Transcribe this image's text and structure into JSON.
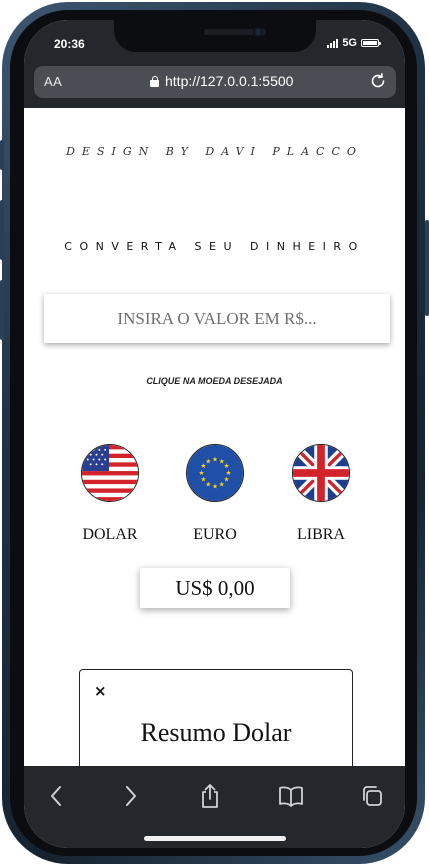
{
  "status_bar": {
    "time": "20:36",
    "network": "5G"
  },
  "browser": {
    "text_size_label": "AA",
    "url": "http://127.0.0.1:5500"
  },
  "page": {
    "credit": "DESIGN BY DAVI PLACCO",
    "headline": "CONVERTA SEU DINHEIRO",
    "input": {
      "placeholder": "INSIRA O VALOR EM R$...",
      "value": ""
    },
    "hint": "CLIQUE NA MOEDA DESEJADA",
    "currencies": [
      {
        "label": "DOLAR",
        "icon": "us-flag-icon"
      },
      {
        "label": "EURO",
        "icon": "eu-flag-icon"
      },
      {
        "label": "LIBRA",
        "icon": "uk-flag-icon"
      }
    ],
    "result": "US$ 0,00",
    "summary": {
      "close": "×",
      "title": "Resumo Dolar"
    }
  },
  "toolbar": {
    "icons": [
      "back-icon",
      "forward-icon",
      "share-icon",
      "bookmarks-icon",
      "tabs-icon"
    ]
  },
  "colors": {
    "bars": "#24272c",
    "url_field": "#4a4e54",
    "frame": "#1f3244"
  }
}
